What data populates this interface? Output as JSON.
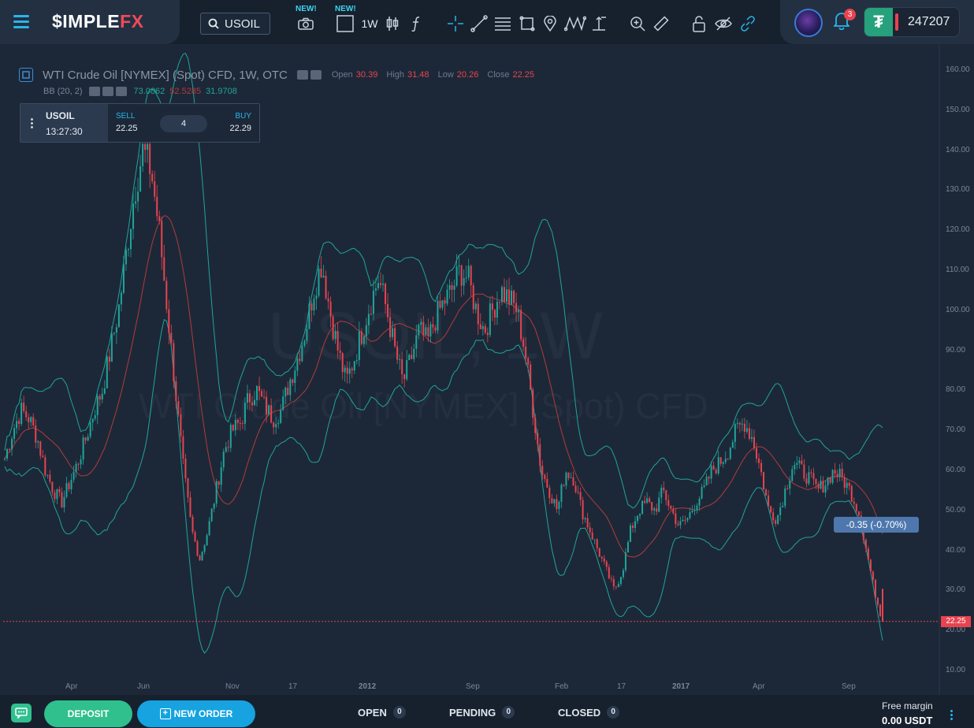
{
  "brand": {
    "logo_main": "$IMPLE",
    "logo_accent": "FX"
  },
  "toolbar": {
    "symbol": "USOIL",
    "new_badge_1": "NEW!",
    "new_badge_2": "NEW!",
    "timeframe": "1W",
    "icons": [
      "search-icon",
      "camera-icon",
      "layout-icon",
      "candles-icon",
      "function-icon",
      "crosshair-icon",
      "trendline-icon",
      "fib-icon",
      "rectangle-icon",
      "pin-icon",
      "pattern-icon",
      "measure-icon",
      "zoom-icon",
      "ruler-icon",
      "lock-icon",
      "eye-off-icon",
      "link-icon"
    ]
  },
  "account": {
    "notifications": "3",
    "balance": "247207",
    "currency_icon": "tether-icon"
  },
  "chart_header": {
    "title": "WTI Crude Oil [NYMEX] (Spot) CFD, 1W, OTC",
    "open_label": "Open",
    "open": "30.39",
    "high_label": "High",
    "high": "31.48",
    "low_label": "Low",
    "low": "20.26",
    "close_label": "Close",
    "close": "22.25",
    "bb_label": "BB (20, 2)",
    "bb_upper": "73.0862",
    "bb_mid": "52.5285",
    "bb_lower": "31.9708"
  },
  "trade_widget": {
    "symbol": "USOIL",
    "time": "13:27:30",
    "sell_label": "SELL",
    "sell_price": "22.25",
    "lot": "4",
    "buy_label": "BUY",
    "buy_price": "22.29"
  },
  "watermark": {
    "line1": "USOIL, 1W",
    "line2": "WTI Crude Oil [NYMEX] (Spot) CFD"
  },
  "price_marker": "22.25",
  "change_marker": "-0.35 (-0.70%)",
  "chart_data": {
    "type": "candlestick",
    "y_ticks": [
      "160.00",
      "150.00",
      "140.00",
      "130.00",
      "120.00",
      "110.00",
      "100.00",
      "90.00",
      "80.00",
      "70.00",
      "60.00",
      "50.00",
      "40.00",
      "30.00",
      "20.00",
      "10.00"
    ],
    "ylim": [
      10,
      160
    ],
    "x_ticks": [
      "Apr",
      "Jun",
      "Nov",
      "17",
      "2012",
      "Sep",
      "Feb",
      "17",
      "2017",
      "Apr",
      "Sep"
    ],
    "indicator": "Bollinger Bands (20, 2)",
    "colors": {
      "up": "#21a49a",
      "down": "#e8434f",
      "band": "#21a49a",
      "mid": "#b43a3a"
    },
    "close_path": [
      63,
      70,
      75,
      73,
      68,
      60,
      55,
      52,
      57,
      62,
      68,
      75,
      80,
      90,
      100,
      115,
      130,
      140,
      135,
      120,
      100,
      80,
      60,
      45,
      38,
      45,
      55,
      65,
      70,
      72,
      78,
      80,
      76,
      73,
      75,
      82,
      88,
      95,
      105,
      112,
      100,
      90,
      82,
      88,
      95,
      102,
      108,
      100,
      90,
      82,
      88,
      95,
      92,
      98,
      102,
      105,
      110,
      108,
      100,
      95,
      100,
      105,
      103,
      100,
      90,
      75,
      60,
      55,
      50,
      60,
      58,
      50,
      45,
      40,
      35,
      30,
      35,
      45,
      50,
      52,
      50,
      55,
      50,
      46,
      48,
      52,
      55,
      60,
      62,
      65,
      70,
      72,
      68,
      60,
      50,
      48,
      55,
      62,
      60,
      58,
      55,
      57,
      60,
      58,
      55,
      50,
      40,
      30,
      22
    ]
  },
  "bottom_bar": {
    "deposit": "DEPOSIT",
    "new_order": "NEW ORDER",
    "tabs": [
      {
        "label": "OPEN",
        "count": "0"
      },
      {
        "label": "PENDING",
        "count": "0"
      },
      {
        "label": "CLOSED",
        "count": "0"
      }
    ],
    "free_margin_label": "Free margin",
    "free_margin_value": "0.00 USDT"
  }
}
